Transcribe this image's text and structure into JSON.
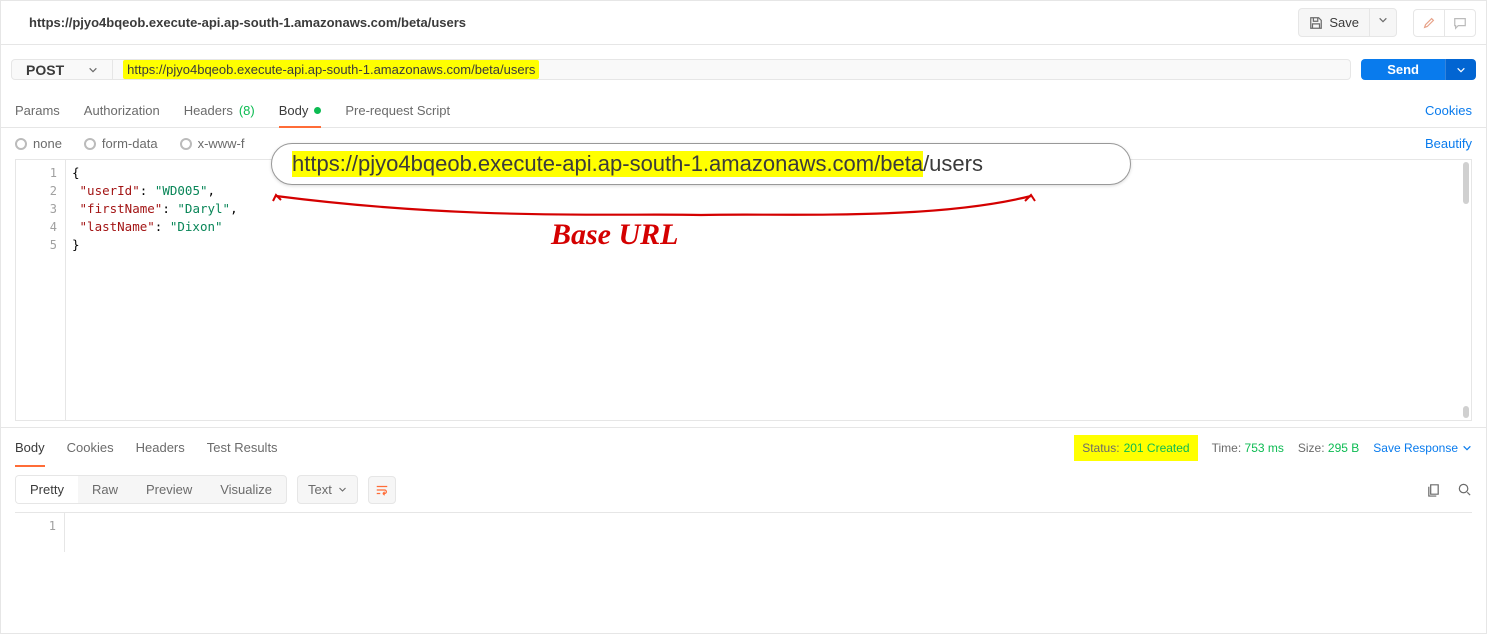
{
  "title": "https://pjyo4bqeob.execute-api.ap-south-1.amazonaws.com/beta/users",
  "toolbar": {
    "save_label": "Save"
  },
  "request": {
    "method": "POST",
    "url": "https://pjyo4bqeob.execute-api.ap-south-1.amazonaws.com/beta/users",
    "send_label": "Send"
  },
  "req_tabs": {
    "params": "Params",
    "authorization": "Authorization",
    "headers_label": "Headers",
    "headers_count": "(8)",
    "body": "Body",
    "prerequest": "Pre-request Script",
    "cookies": "Cookies"
  },
  "body_types": {
    "none": "none",
    "formdata": "form-data",
    "xwww": "x-www-f",
    "beautify": "Beautify"
  },
  "editor": {
    "line_numbers": [
      "1",
      "2",
      "3",
      "4",
      "5"
    ],
    "lines": {
      "l1": "{",
      "l2_key": "\"userId\"",
      "l2_val": "\"WD005\"",
      "l3_key": "\"firstName\"",
      "l3_val": "\"Daryl\"",
      "l4_key": "\"lastName\"",
      "l4_val": "\"Dixon\"",
      "l5": "}"
    }
  },
  "resp_tabs": {
    "body": "Body",
    "cookies": "Cookies",
    "headers": "Headers",
    "test_results": "Test Results"
  },
  "status": {
    "status_label": "Status:",
    "status_value": "201 Created",
    "time_label": "Time:",
    "time_value": "753 ms",
    "size_label": "Size:",
    "size_value": "295 B",
    "save_response": "Save Response"
  },
  "resp_toolbar": {
    "pretty": "Pretty",
    "raw": "Raw",
    "preview": "Preview",
    "visualize": "Visualize",
    "format": "Text"
  },
  "resp_editor": {
    "line_numbers": [
      "1"
    ],
    "content": ""
  },
  "annotation": {
    "url_base": "https://pjyo4bqeob.execute-api.ap-south-1.amazonaws.com/beta",
    "url_path": "/users",
    "label": "Base URL"
  }
}
